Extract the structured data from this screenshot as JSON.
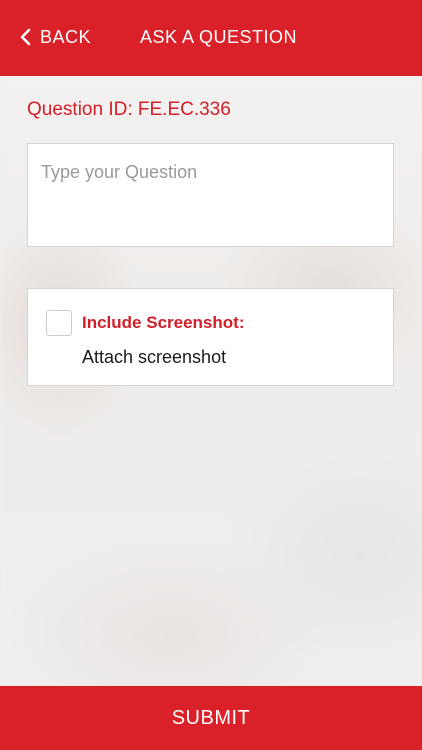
{
  "header": {
    "back_label": "BACK",
    "title": "ASK A QUESTION",
    "accent_color": "#da2028"
  },
  "question_id_label": "Question ID: FE.EC.336",
  "question_input": {
    "placeholder": "Type your Question",
    "value": ""
  },
  "screenshot": {
    "include_label": "Include Screenshot:",
    "attach_label": "Attach screenshot",
    "checked": false
  },
  "submit_label": "SUBMIT",
  "icons": {
    "back": "chevron-left-icon"
  }
}
